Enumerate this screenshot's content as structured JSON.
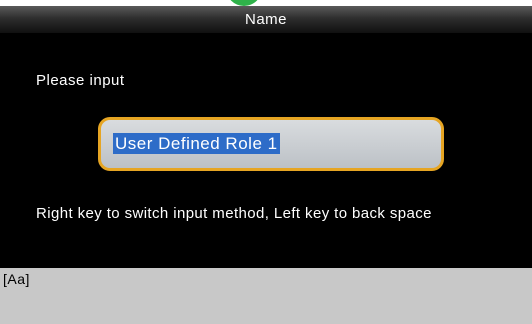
{
  "header": {
    "title": "Name"
  },
  "form": {
    "prompt": "Please input",
    "input_value": "User Defined Role 1",
    "hint": "Right key to switch input method, Left key to back space"
  },
  "status": {
    "input_mode": "[Aa]"
  },
  "colors": {
    "accent_border": "#e6a523",
    "selection": "#2d6cc8",
    "indicator": "#2fb24a"
  }
}
